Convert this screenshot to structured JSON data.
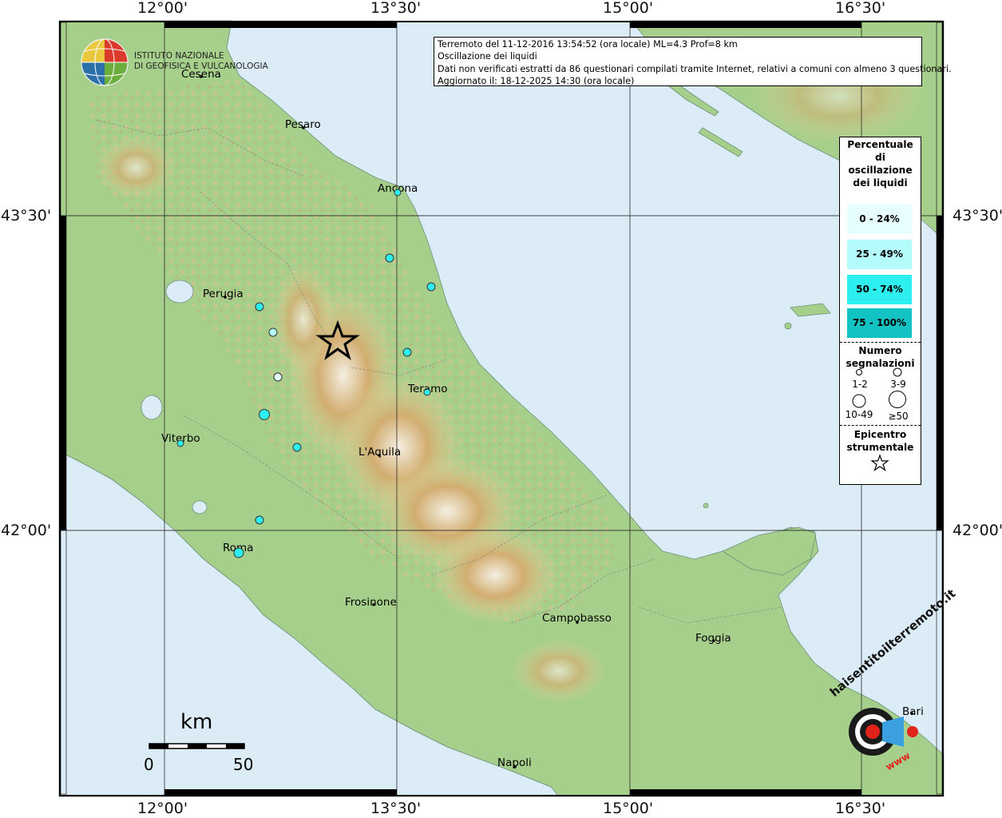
{
  "map": {
    "axes": {
      "lon_labels": [
        "12°00'",
        "13°30'",
        "15°00'",
        "16°30'"
      ],
      "lat_labels": [
        "43°30'",
        "42°00'"
      ]
    },
    "title_box": {
      "line1": "Terremoto del 11-12-2016 13:54:52 (ora locale) ML=4.3 Prof=8 km",
      "line2": "Oscillazione dei liquidi",
      "line3": "Dati non verificati estratti da 86 questionari compilati tramite Internet, relativi a comuni con almeno 3 questionari.",
      "line4": "Aggiornato il: 18-12-2025 14:30 (ora locale)"
    },
    "logo": {
      "line1": "ISTITUTO NAZIONALE",
      "line2": "DI GEOFISICA E VULCANOLOGIA"
    },
    "cities": [
      {
        "name": "Cesena"
      },
      {
        "name": "Pesaro"
      },
      {
        "name": "Ancona"
      },
      {
        "name": "Perugia"
      },
      {
        "name": "Teramo"
      },
      {
        "name": "Viterbo"
      },
      {
        "name": "L'Aquila"
      },
      {
        "name": "Roma"
      },
      {
        "name": "Frosinone"
      },
      {
        "name": "Campobasso"
      },
      {
        "name": "Foggia"
      },
      {
        "name": "Napoli"
      },
      {
        "name": "Bari"
      }
    ],
    "legend": {
      "title": "Percentuale di oscillazione dei liquidi",
      "classes": [
        {
          "label": "0 - 24%",
          "color": "#e6fefe"
        },
        {
          "label": "25 - 49%",
          "color": "#b4fbfb"
        },
        {
          "label": "50 - 74%",
          "color": "#2eefef"
        },
        {
          "label": "75 - 100%",
          "color": "#13c2c2"
        }
      ],
      "size_title": "Numero segnalazioni",
      "size_labels": [
        "1-2",
        "3-9",
        "10-49",
        "≥50"
      ],
      "epicenter_title": "Epicentro strumentale"
    },
    "scale_bar": {
      "unit": "km",
      "start": "0",
      "end": "50"
    },
    "watermark": {
      "text": "haisentitoilterremoto.it",
      "url": "www"
    },
    "colors": {
      "sea": "#dcecf6",
      "land_low": "#a9d08e",
      "land_mid": "#e3d9a4",
      "land_high": "#c49a5e",
      "grid": "#222222"
    }
  }
}
